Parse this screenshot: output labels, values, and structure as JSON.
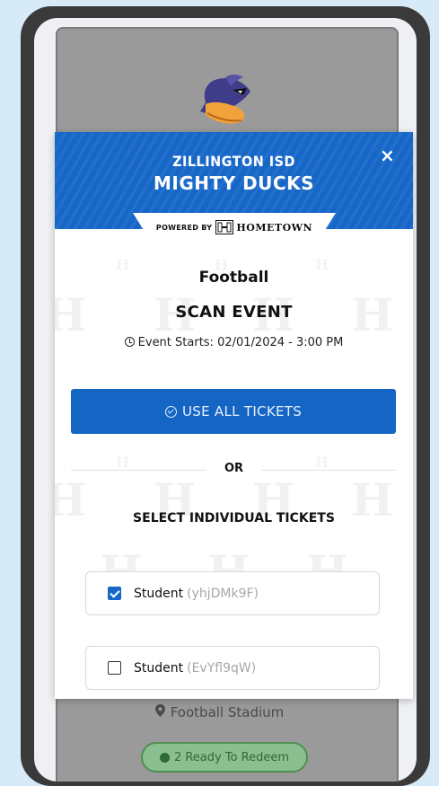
{
  "modal": {
    "school": "ZILLINGTON ISD",
    "team": "MIGHTY DUCKS",
    "close_glyph": "×",
    "powered_by": "POWERED BY",
    "brand": "HOMETOWN",
    "sport": "Football",
    "heading": "SCAN EVENT",
    "event_starts": "Event Starts: 02/01/2024 - 3:00 PM",
    "use_all_label": "USE ALL TICKETS",
    "or_label": "OR",
    "select_label": "SELECT INDIVIDUAL TICKETS",
    "tickets": [
      {
        "label": "Student",
        "code": "(yhjDMk9F)",
        "checked": true
      },
      {
        "label": "Student",
        "code": "(EvYfl9qW)",
        "checked": false
      }
    ]
  },
  "background": {
    "location": "Football Stadium",
    "redeem": "2 Ready To Redeem"
  },
  "colors": {
    "brand_blue": "#1667c8",
    "page_bg": "#d6eaf8",
    "device": "#3a3a3a",
    "redeem_green": "#8cbf8f"
  },
  "icons": [
    "duck-mascot-icon",
    "close-icon",
    "hometown-logo-icon",
    "clock-icon",
    "check-circle-icon",
    "checkbox-icon",
    "location-pin-icon",
    "check-dot-icon"
  ]
}
